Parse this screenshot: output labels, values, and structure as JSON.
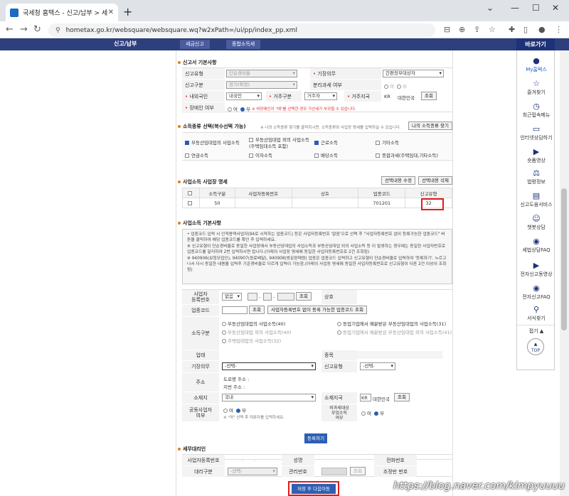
{
  "browser": {
    "tab_title": "국세청 홈택스 - 신고/납부 > 세",
    "url": "hometax.go.kr/websquare/websquare.wq?w2xPath=/ui/pp/index_pp.xml"
  },
  "site_nav": {
    "menu": "신고/납부",
    "crumbs": [
      "세금신고",
      "종합소득세"
    ]
  },
  "sidebar": {
    "header": "바로가기",
    "items": [
      {
        "label": "My홈택스",
        "icon": "person-icon"
      },
      {
        "label": "즐겨찾기",
        "icon": "star-icon"
      },
      {
        "label": "최근접속메뉴",
        "icon": "clock-icon"
      },
      {
        "label": "인터넷상담하기",
        "icon": "chat-icon"
      },
      {
        "label": "숏폼영상",
        "icon": "video-icon"
      },
      {
        "label": "법령정보",
        "icon": "gavel-icon"
      },
      {
        "label": "신고도움서비스",
        "icon": "book-icon"
      },
      {
        "label": "챗봇상담",
        "icon": "bot-icon"
      },
      {
        "label": "세법상담FAQ",
        "icon": "faq-icon"
      },
      {
        "label": "전자신고동영상",
        "icon": "play-icon"
      },
      {
        "label": "전자신고FAQ",
        "icon": "faq2-icon"
      },
      {
        "label": "서식찾기",
        "icon": "search-icon"
      }
    ],
    "fold": "접기 ▲",
    "top": "TOP"
  },
  "s1": {
    "title": "신고서 기본사항",
    "report_type_label": "신고유형",
    "report_type_value": "간편장부대상자",
    "filing_kind_label": "신고구분",
    "filing_kind_value": "정기(확정)",
    "basic_value": "단순경비율",
    "duty_label": "기장의무",
    "duty_value": "간편장부대상자",
    "separate_label": "분리과세 여부",
    "opt_yes": "여",
    "opt_no": "부",
    "foreigner_label": "내외국인",
    "foreigner_value": "내국인",
    "residence_label": "거주구분",
    "residence_value": "거주자",
    "region_label": "거주지국",
    "region_code": "KR",
    "region_name": "대한민국",
    "lookup": "조회",
    "disabled_label": "장애인 여부",
    "disabled_note": "※ 비장애인이 \"예\"를 선택한 경우 가산세가 부과될 수 있습니다."
  },
  "s2": {
    "title": "소득종류 선택(복수선택 가능)",
    "note": "※ 나의 소득종류 찾기를 클릭하시면, 소득종류와 사업장 명세를 입력하실 수 있습니다.",
    "find_btn": "나의 소득종류 찾기",
    "opts": [
      "부동산임대업의 사업소득",
      "부동산임대업 외의 사업소득\n(주택임대소득 포함)",
      "근로소득",
      "기타소득",
      "연금소득",
      "이자소득",
      "배당소득",
      "종합과세(주택임대,기타소득)"
    ]
  },
  "s3": {
    "title": "사업소득 사업장 명세",
    "edit_btn": "선택내용 수정",
    "delete_btn": "선택내용 삭제",
    "headers": [
      "",
      "소득구분",
      "사업자등록번호",
      "상호",
      "업종코드",
      "신고유형"
    ],
    "row": [
      "",
      "50",
      "",
      "",
      "701201",
      "32"
    ]
  },
  "s4": {
    "title": "사업소득 기본사항",
    "info": "• 업종코드 입력 시 인적용역사업자(94로 시작하는 업종코드) 등은 사업자등록번호 '없음'으로 선택 후 \"사업자등록번호 없이 등록가능한 업종코드\" 버튼을 클릭하여 해당 업종코드를 확인 후 입력하세요.\n※ 신고유형이 단순경비율로 동일한 사업장에서 부동산임대업의 사업소득과 부동산임대업 외의 사업소득 등 이 발생하는 경우에는 동일한 사업자번호로 업종코드를 달리하여 2번 입력하시면 됩니다.(아래의 사업장 명세에 동일한 사업자등록번호로 2건 조회됨)\n※ 940906(보험모집인), 940907(음료배달), 940908(방문판매원) 업종은 업종코드 입력하고 신고유형이 단순경비율로 입력하여 '등록하기'. 누르고 나서 다시 동일한 내용을 입력후 기준경비율로 다르게 입력이 가능함.(아래의 사업장 명세에 동일한 사업자등록번호로 신고유형이 다른 2건 이상이 조회됨)",
    "biz_no_label": "사업자\n등록번호",
    "biz_no_opt": "없음",
    "lookup": "조회",
    "trade_name_label": "상호",
    "industry_label": "업종코드",
    "industry_lookup": "조회",
    "industry_no_reg_btn": "사업자등록번호 없이 등록 가능한 업종코드 조회",
    "income_type_label": "소득구분",
    "income_opts": [
      "부동산임대업의 사업소득(40)",
      "동업기업에서 배분받은 부동산임대업의 사업소득(31)",
      "부동산임대업 외의 사업소득(40)",
      "동업기업에서 배분받은 부동산임대업 외의 사업소득(41)",
      "주택임대업의 사업소득(32)"
    ],
    "business_label": "업태",
    "item_label": "종목",
    "duty_label": "기장의무",
    "duty_value": "-선택-",
    "report_type_label": "신고유형",
    "report_type_value": "-선택-",
    "address_label": "주소",
    "road_addr": "도로명 주소 :",
    "lot_addr": "지번 주소 :",
    "location_label": "소재지",
    "location_value": "국내",
    "location_country_label": "소재지국",
    "location_code": "KR",
    "location_name": "대한민국",
    "location_lookup": "조회",
    "joint_label": "공동사업자\n여부",
    "joint_note": "※ \"여\" 선택 후 대표자를 입력하세요.",
    "tax_exempt_label": "비과세대상\n부업소득\n여부",
    "register_btn": "등록하기"
  },
  "s5": {
    "title": "세무대리인",
    "biz_no_label": "사업자등록번호",
    "name_label": "성명",
    "phone_label": "전화번호",
    "agent_type_label": "대리구분",
    "agent_type_value": "-선택-",
    "mgmt_no_label": "관리번호",
    "mgmt_lookup": "조회",
    "adjust_no_label": "조정반 번호"
  },
  "footer": {
    "next_btn": "저장 후 다음이동"
  },
  "watermark": "https://blog.naver.com/kimpyuuuu"
}
